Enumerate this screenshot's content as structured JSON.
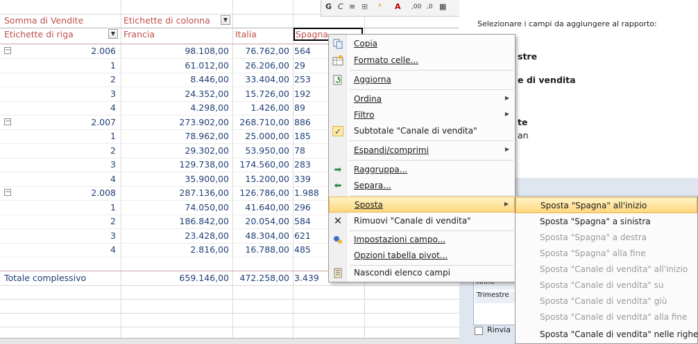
{
  "mini_toolbar": [
    "G",
    "C",
    "≡",
    "⊞",
    "ᴬ",
    "A",
    ",00",
    ",0",
    "▦"
  ],
  "pivot": {
    "corner_label": "Somma di Vendite",
    "col_labels_header": "Etichette di colonna",
    "row_labels_header": "Etichette di riga",
    "columns": [
      "Francia",
      "Italia",
      "Spagna",
      "Totale complessivo"
    ],
    "rows": [
      {
        "label": "2.006",
        "level": 0,
        "francia": "98.108,00",
        "italia": "76.762,00",
        "spagna": "564"
      },
      {
        "label": "1",
        "level": 1,
        "francia": "61.012,00",
        "italia": "26.206,00",
        "spagna": "29"
      },
      {
        "label": "2",
        "level": 1,
        "francia": "8.446,00",
        "italia": "33.404,00",
        "spagna": "253"
      },
      {
        "label": "3",
        "level": 1,
        "francia": "24.352,00",
        "italia": "15.726,00",
        "spagna": "192"
      },
      {
        "label": "4",
        "level": 1,
        "francia": "4.298,00",
        "italia": "1.426,00",
        "spagna": "89"
      },
      {
        "label": "2.007",
        "level": 0,
        "francia": "273.902,00",
        "italia": "268.710,00",
        "spagna": "886"
      },
      {
        "label": "1",
        "level": 1,
        "francia": "78.962,00",
        "italia": "25.000,00",
        "spagna": "185"
      },
      {
        "label": "2",
        "level": 1,
        "francia": "29.302,00",
        "italia": "53.950,00",
        "spagna": "78"
      },
      {
        "label": "3",
        "level": 1,
        "francia": "129.738,00",
        "italia": "174.560,00",
        "spagna": "283"
      },
      {
        "label": "4",
        "level": 1,
        "francia": "35.900,00",
        "italia": "15.200,00",
        "spagna": "339"
      },
      {
        "label": "2.008",
        "level": 0,
        "francia": "287.136,00",
        "italia": "126.786,00",
        "spagna": "1.988"
      },
      {
        "label": "1",
        "level": 1,
        "francia": "74.050,00",
        "italia": "41.640,00",
        "spagna": "296"
      },
      {
        "label": "2",
        "level": 1,
        "francia": "186.842,00",
        "italia": "20.054,00",
        "spagna": "584"
      },
      {
        "label": "3",
        "level": 1,
        "francia": "23.428,00",
        "italia": "48.304,00",
        "spagna": "621"
      },
      {
        "label": "4",
        "level": 1,
        "francia": "2.816,00",
        "italia": "16.788,00",
        "spagna": "485"
      }
    ],
    "total": {
      "label": "Totale complessivo",
      "francia": "659.146,00",
      "italia": "472.258,00",
      "spagna": "3.439"
    }
  },
  "panel": {
    "instruction": "Selezionare i campi da aggiungere al rapporto:",
    "field_1": "stre",
    "field_2": "e di vendita",
    "field_3": "te",
    "field_4": "an",
    "row_box_item_1": "Anno",
    "row_box_item_2": "Trimestre",
    "defer_label": "Rinvia"
  },
  "context_menu": {
    "items": [
      {
        "label": "Copia",
        "icon": "copy-icon"
      },
      {
        "label": "Formato celle...",
        "icon": "format-cells-icon"
      },
      {
        "label": "Aggiorna",
        "icon": "refresh-icon"
      },
      {
        "label": "Ordina",
        "submenu": true
      },
      {
        "label": "Filtro",
        "submenu": true
      },
      {
        "label": "Subtotale \"Canale di vendita\"",
        "icon": "check-icon"
      },
      {
        "label": "Espandi/comprimi",
        "submenu": true
      },
      {
        "label": "Raggruppa...",
        "icon": "group-icon"
      },
      {
        "label": "Separa...",
        "icon": "ungroup-icon"
      },
      {
        "label": "Sposta",
        "submenu": true,
        "highlighted": true
      },
      {
        "label": "Rimuovi \"Canale di vendita\"",
        "icon": "remove-icon"
      },
      {
        "label": "Impostazioni campo...",
        "icon": "field-settings-icon"
      },
      {
        "label": "Opzioni tabella pivot..."
      },
      {
        "label": "Nascondi elenco campi",
        "icon": "field-list-icon"
      }
    ]
  },
  "submenu": {
    "items": [
      {
        "label": "Sposta \"Spagna\" all'inizio",
        "enabled": true,
        "highlighted": true
      },
      {
        "label": "Sposta \"Spagna\" a sinistra",
        "enabled": true
      },
      {
        "label": "Sposta \"Spagna\" a destra",
        "enabled": false
      },
      {
        "label": "Sposta \"Spagna\" alla fine",
        "enabled": false
      },
      {
        "label": "Sposta \"Canale di vendita\" all'inizio",
        "enabled": false
      },
      {
        "label": "Sposta \"Canale di vendita\" su",
        "enabled": false
      },
      {
        "label": "Sposta \"Canale di vendita\" giù",
        "enabled": false
      },
      {
        "label": "Sposta \"Canale di vendita\" alla fine",
        "enabled": false
      },
      {
        "label": "Sposta \"Canale di vendita\" nelle righe",
        "enabled": true
      }
    ]
  },
  "colors": {
    "header_text": "#c0504d",
    "value_text": "#1f3f75",
    "highlight": "#ffd77e"
  }
}
